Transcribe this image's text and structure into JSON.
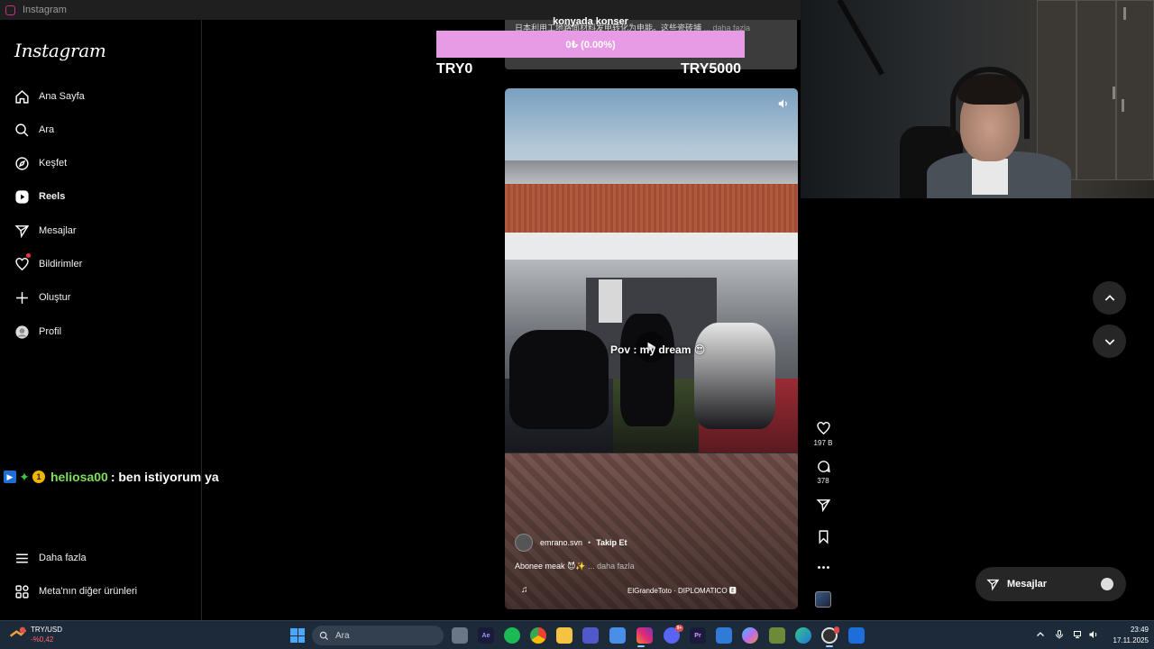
{
  "window": {
    "title": "Instagram"
  },
  "sidebar": {
    "logo": "Instagram",
    "items": [
      {
        "label": "Ana Sayfa",
        "icon": "home-icon"
      },
      {
        "label": "Ara",
        "icon": "search-icon"
      },
      {
        "label": "Keşfet",
        "icon": "compass-icon"
      },
      {
        "label": "Reels",
        "icon": "reels-icon",
        "active": true
      },
      {
        "label": "Mesajlar",
        "icon": "paper-plane-icon"
      },
      {
        "label": "Bildirimler",
        "icon": "heart-icon"
      },
      {
        "label": "Oluştur",
        "icon": "plus-icon"
      },
      {
        "label": "Profil",
        "icon": "profile-avatar-icon"
      }
    ],
    "bottom_items": [
      {
        "label": "Daha fazla",
        "icon": "hamburger-menu-icon"
      },
      {
        "label": "Meta'nın diğer ürünleri",
        "icon": "grid-icon"
      }
    ]
  },
  "chat": {
    "username": "heliosa00",
    "message": ": ben istiyorum ya"
  },
  "donation": {
    "title": "konyada konser",
    "amount": "0₺ (0.00%)",
    "min": "TRY0",
    "max": "TRY5000",
    "progress": 0,
    "bar_color": "#e79be5"
  },
  "previous_reel": {
    "caption": "日本利用工地路面材料发电转化为电能。这些瓷砖捕",
    "more": "... daha fazla"
  },
  "reel": {
    "overlay_text": "Pov : my dream 😍",
    "author": "emrano.svn",
    "follow": "Takip Et",
    "caption": "Abonee meak 😈✨",
    "caption_more": "... daha fazla",
    "audio": "ElGrandeToto · DIPLOMATICO 🅴"
  },
  "actions": {
    "likes": "197 B",
    "comments": "378"
  },
  "messages_pill": {
    "label": "Mesajlar"
  },
  "taskbar": {
    "ticker_name": "TRY/USD",
    "ticker_change": "-%0,42",
    "search_placeholder": "Ara",
    "apps": [
      "file-explorer",
      "after-effects",
      "spotify",
      "chrome",
      "folder",
      "teams",
      "store",
      "instagram",
      "discord",
      "premiere",
      "mail",
      "copilot",
      "minecraft",
      "edge",
      "obs",
      "app"
    ],
    "time": "23:49",
    "date": "17.11.2025"
  },
  "colors": {
    "accent_donation": "#e79be5",
    "chat_username": "#7fe05b",
    "notification": "#ff3040"
  }
}
